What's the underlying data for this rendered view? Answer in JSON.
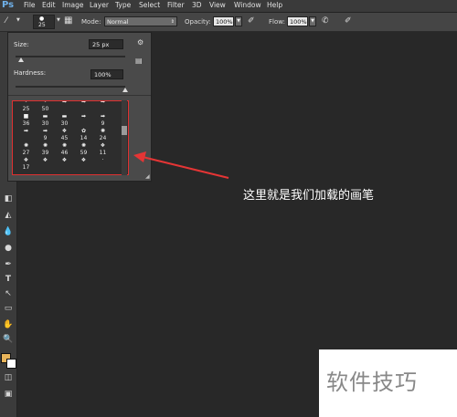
{
  "menubar": {
    "logo": "Ps",
    "items": [
      "File",
      "Edit",
      "Image",
      "Layer",
      "Type",
      "Select",
      "Filter",
      "3D",
      "View",
      "Window",
      "Help"
    ]
  },
  "options": {
    "brush_size": "25",
    "mode_label": "Mode:",
    "mode_value": "Normal",
    "opacity_label": "Opacity:",
    "opacity_value": "100%",
    "flow_label": "Flow:",
    "flow_value": "100%"
  },
  "brush_panel": {
    "size_label": "Size:",
    "size_value": "25 px",
    "size_fraction": 0.05,
    "hardness_label": "Hardness:",
    "hardness_value": "100%",
    "hardness_fraction": 1.0,
    "presets": [
      {
        "glyph": "•",
        "num": "25"
      },
      {
        "glyph": "•",
        "num": "50"
      },
      {
        "glyph": "➡",
        "num": ""
      },
      {
        "glyph": "➡",
        "num": ""
      },
      {
        "glyph": "➡",
        "num": ""
      },
      {
        "glyph": "■",
        "num": "36"
      },
      {
        "glyph": "▬",
        "num": "30"
      },
      {
        "glyph": "▬",
        "num": "30"
      },
      {
        "glyph": "➡",
        "num": ""
      },
      {
        "glyph": "➡",
        "num": "9"
      },
      {
        "glyph": "➡",
        "num": ""
      },
      {
        "glyph": "➡",
        "num": "9"
      },
      {
        "glyph": "❖",
        "num": "45"
      },
      {
        "glyph": "✿",
        "num": "14"
      },
      {
        "glyph": "✺",
        "num": "24"
      },
      {
        "glyph": "✺",
        "num": "27"
      },
      {
        "glyph": "✺",
        "num": "39"
      },
      {
        "glyph": "✺",
        "num": "46"
      },
      {
        "glyph": "✺",
        "num": "59"
      },
      {
        "glyph": "❖",
        "num": "11"
      },
      {
        "glyph": "❖",
        "num": "17"
      },
      {
        "glyph": "❖",
        "num": ""
      },
      {
        "glyph": "❖",
        "num": ""
      },
      {
        "glyph": "❖",
        "num": ""
      },
      {
        "glyph": "·",
        "num": ""
      }
    ]
  },
  "annotation": {
    "text": "这里就是我们加载的画笔",
    "arrow_color": "#e53535"
  },
  "watermark": {
    "text": "软件技巧"
  },
  "colors": {
    "foreground_swatch": "#e8b45a",
    "background_swatch": "#ffffff",
    "highlight_border": "#e03030"
  }
}
